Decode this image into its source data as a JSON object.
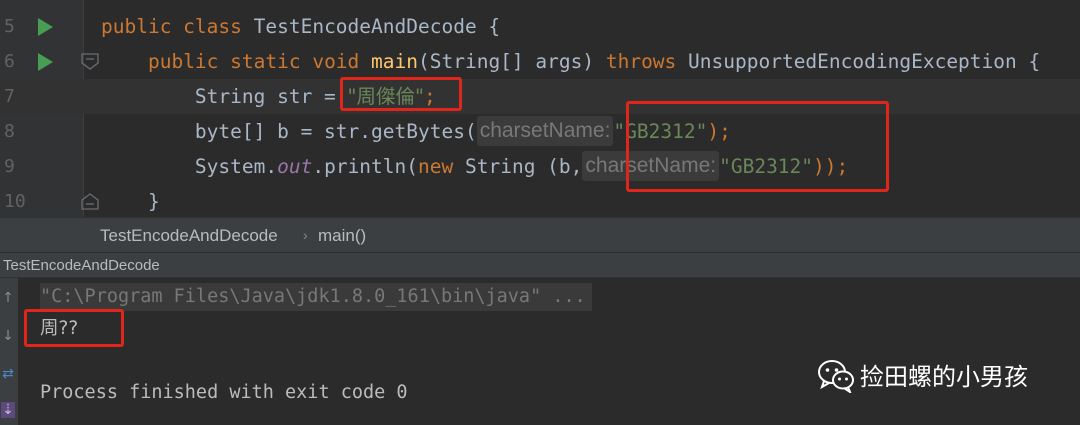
{
  "editor": {
    "lines": [
      {
        "number": "5",
        "tokens": {
          "kw": "public class ",
          "name": "TestEncodeAndDecode",
          "brace": " {"
        }
      },
      {
        "number": "6",
        "tokens": {
          "indent": "    ",
          "kw1": "public static void ",
          "fn": "main",
          "params": "(String[] args) ",
          "kw2": "throws",
          "rest": " UnsupportedEncodingException {"
        }
      },
      {
        "number": "7",
        "tokens": {
          "indent": "        ",
          "decl": "String str = ",
          "str": "\"周傑倫\"",
          "end": ";"
        }
      },
      {
        "number": "8",
        "tokens": {
          "indent": "        ",
          "decl": "byte[] b = str.getBytes(",
          "hint": "charsetName:",
          "str": "\"GB2312\"",
          "end": ");"
        }
      },
      {
        "number": "9",
        "tokens": {
          "indent": "        ",
          "sys": "System.",
          "out": "out",
          "call": ".println(",
          "kw": "new",
          "ctor": " String (b,",
          "hint": "charsetName:",
          "str": "\"GB2312\"",
          "end": "));"
        }
      },
      {
        "number": "10",
        "tokens": {
          "indent": "    ",
          "brace": "}"
        }
      }
    ]
  },
  "breadcrumb": {
    "class_name": "TestEncodeAndDecode",
    "separator": "›",
    "method": "main()"
  },
  "run_panel": {
    "title": "TestEncodeAndDecode",
    "command": "\"C:\\Program Files\\Java\\jdk1.8.0_161\\bin\\java\" ...",
    "output": "周??",
    "exit_message": "Process finished with exit code 0"
  },
  "watermark": {
    "text": "捡田螺的小男孩",
    "icon": "wechat-icon"
  },
  "colors": {
    "editor_bg": "#2b2b2b",
    "gutter_bg": "#313335",
    "keyword": "#cc7832",
    "function": "#ffc66d",
    "string": "#6a8759",
    "static_field": "#9876aa",
    "highlight_box": "#e0251a",
    "run_icon": "#499c54"
  },
  "icons": {
    "run": "run-icon",
    "fold": "fold-icon"
  }
}
